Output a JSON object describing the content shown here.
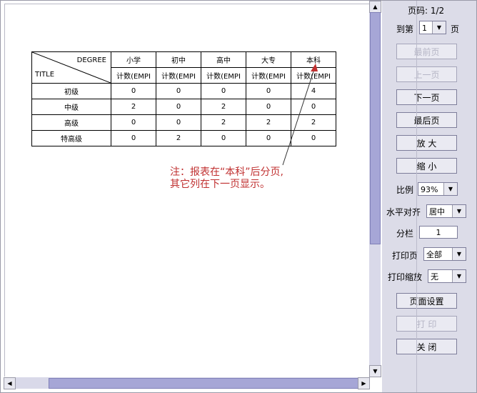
{
  "report": {
    "diag_top": "DEGREE",
    "diag_bottom": "TITLE",
    "columns": [
      "小学",
      "初中",
      "高中",
      "大专",
      "本科"
    ],
    "subheader": [
      "计数(EMPI",
      "计数(EMPI",
      "计数(EMPI",
      "计数(EMPI",
      "计数(EMPI"
    ],
    "rows": [
      {
        "label": "初级",
        "values": [
          "0",
          "0",
          "0",
          "0",
          "4"
        ]
      },
      {
        "label": "中级",
        "values": [
          "2",
          "0",
          "2",
          "0",
          "0"
        ]
      },
      {
        "label": "高级",
        "values": [
          "0",
          "0",
          "2",
          "2",
          "2"
        ]
      },
      {
        "label": "特高级",
        "values": [
          "0",
          "2",
          "0",
          "0",
          "0"
        ]
      }
    ]
  },
  "note": {
    "line1": "注：报表在“本科”后分页,",
    "line2": "其它列在下一页显示。",
    "color": "#c03030"
  },
  "panel": {
    "page_info": "页码: 1/2",
    "goto_label_pre": "到第",
    "goto_value": "1",
    "goto_label_post": "页",
    "btn_first": "最前页",
    "btn_prev": "上一页",
    "btn_next": "下一页",
    "btn_last": "最后页",
    "btn_zoom_in": "放  大",
    "btn_zoom_out": "缩  小",
    "scale_label": "比例",
    "scale_value": "93%",
    "align_label": "水平对齐",
    "align_value": "居中",
    "columns_label": "分栏",
    "columns_value": "1",
    "print_pages_label": "打印页",
    "print_pages_value": "全部",
    "print_scale_label": "打印缩放",
    "print_scale_value": "无",
    "btn_page_setup": "页面设置",
    "btn_print": "打  印",
    "btn_close": "关  闭"
  },
  "colors": {
    "panel_bg": "#dcdce8",
    "scroll_thumb": "#a6a6d6",
    "disabled_text": "#b5b5c5"
  }
}
